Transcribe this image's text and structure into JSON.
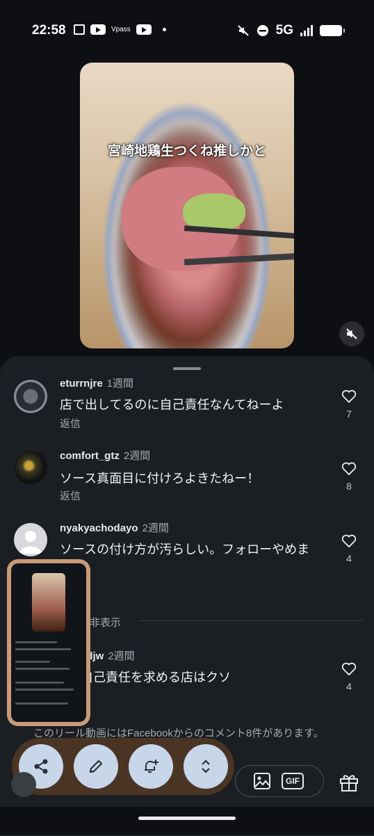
{
  "status_bar": {
    "time": "22:58",
    "carrier_label": "Vpass",
    "network": "5G"
  },
  "video": {
    "caption": "宮崎地鶏生つくね推しかと"
  },
  "comments": [
    {
      "user": "eturrnjre",
      "time": "1週間",
      "text": "店で出してるのに自己責任なんてねーよ",
      "reply": "返信",
      "likes": "7"
    },
    {
      "user": "comfort_gtz",
      "time": "2週間",
      "text": "ソース真面目に付けろよきたねー！",
      "reply": "返信",
      "likes": "8"
    },
    {
      "user": "nyakyachodayo",
      "time": "2週間",
      "text": "ソースの付け方が汚らしい。フォローやめま",
      "reply": "",
      "likes": "4"
    },
    {
      "user": "adjw",
      "time": "2週間",
      "text": "自己責任を求める店はクソ",
      "reply": "",
      "likes": "4"
    }
  ],
  "hidden_label": "の非表示",
  "facebook_note": "このリール動画にはFacebookからのコメント8件があります。",
  "input": {
    "gif_label": "GIF"
  },
  "icons": {
    "share": "share-icon",
    "edit": "pencil-icon",
    "reminder": "bell-plus-icon",
    "expand": "chevron-updown-icon",
    "image": "image-icon",
    "gift": "gift-icon",
    "mute": "speaker-muted-icon",
    "heart": "heart-icon"
  }
}
